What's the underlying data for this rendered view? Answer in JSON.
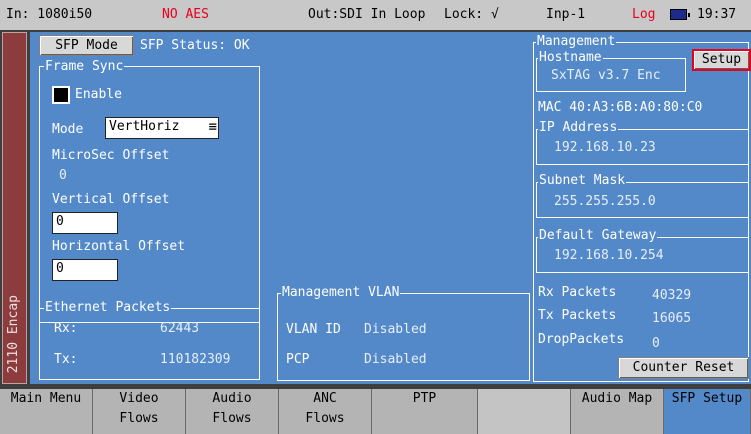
{
  "status": {
    "format": "In: 1080i50",
    "aes": "NO AES",
    "out": "Out:SDI In Loop",
    "lock": "Lock: √",
    "input": "Inp-1",
    "log": "Log",
    "time": "19:37"
  },
  "side_tab": {
    "label": "2110 Encap"
  },
  "sfp": {
    "mode_button": "SFP Mode",
    "status": "SFP Status: OK"
  },
  "frame_sync": {
    "legend": "Frame Sync",
    "enable_label": "Enable",
    "mode_label": "Mode",
    "mode_value": "VertHoriz",
    "microsec_label": "MicroSec Offset",
    "microsec_value": "0",
    "vertical_label": "Vertical Offset",
    "vertical_value": "0",
    "horizontal_label": "Horizontal Offset",
    "horizontal_value": "0"
  },
  "ethernet": {
    "legend": "Ethernet Packets",
    "rx_label": "Rx:",
    "rx_value": "62443",
    "tx_label": "Tx:",
    "tx_value": "110182309"
  },
  "vlan": {
    "legend": "Management VLAN",
    "id_label": "VLAN ID",
    "id_value": "Disabled",
    "pcp_label": "PCP",
    "pcp_value": "Disabled"
  },
  "management": {
    "legend": "Management",
    "setup_button": "Setup",
    "hostname_legend": "Hostname",
    "hostname": "SxTAG v3.7 Enc",
    "mac": "MAC 40:A3:6B:A0:80:C0",
    "ip_legend": "IP Address",
    "ip": "192.168.10.23",
    "subnet_legend": "Subnet Mask",
    "subnet": "255.255.255.0",
    "gateway_legend": "Default Gateway",
    "gateway": "192.168.10.254",
    "rx_label": "Rx Packets",
    "rx_value": "40329",
    "tx_label": "Tx Packets",
    "tx_value": "16065",
    "drop_label": "DropPackets",
    "drop_value": "0",
    "counter_reset": "Counter Reset"
  },
  "menu": [
    {
      "line1": "Main Menu",
      "line2": ""
    },
    {
      "line1": "Video",
      "line2": "Flows"
    },
    {
      "line1": "Audio",
      "line2": "Flows"
    },
    {
      "line1": "ANC",
      "line2": "Flows"
    },
    {
      "line1": "PTP",
      "line2": ""
    },
    {
      "line1": "",
      "line2": ""
    },
    {
      "line1": "Audio Map",
      "line2": ""
    },
    {
      "line1": "SFP Setup",
      "line2": ""
    }
  ],
  "colors": {
    "panel": "#5389c9",
    "status_bar": "#c8c8c8",
    "alert": "#e8001c",
    "side_tab": "#8c3c3c",
    "menu": "#b4b4b4"
  }
}
